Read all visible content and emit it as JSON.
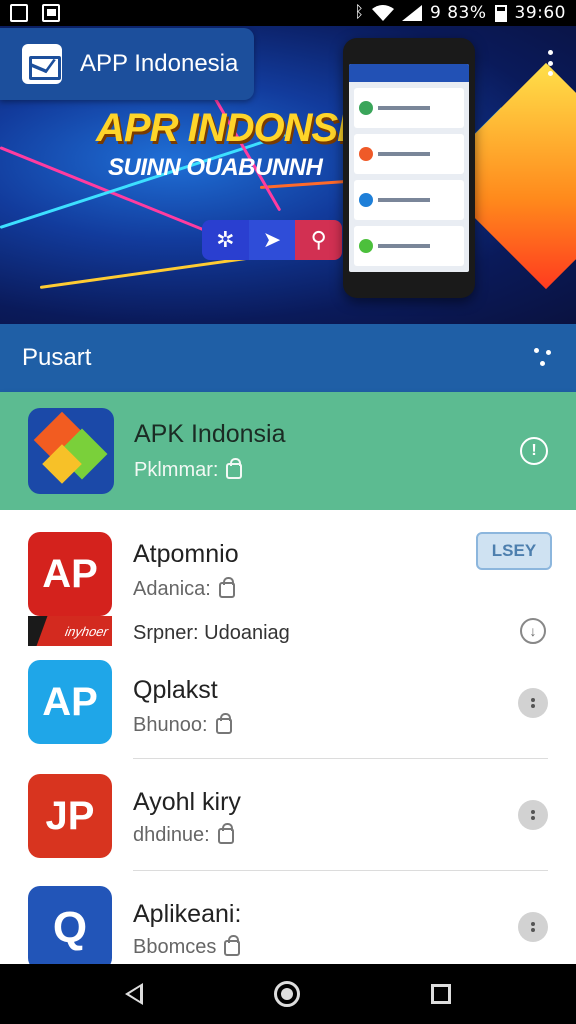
{
  "status_bar": {
    "battery_text": "9 83%",
    "time": "39:60",
    "icons": [
      "image-icon",
      "flag-icon",
      "bluetooth-icon",
      "wifi-icon",
      "signal-icon",
      "battery-icon"
    ]
  },
  "banner": {
    "app_title": "APP Indonesia",
    "headline": "APR INDONSIA",
    "subline": "SUINN OUABUNNH",
    "colors": {
      "headline": "#ffd52a",
      "bg": "#123b9c"
    }
  },
  "section": {
    "label": "Pusart"
  },
  "featured": {
    "name": "APK Indonsia",
    "sub": "Pklmmar:",
    "accent": "#5cbb91"
  },
  "list": [
    {
      "name": "Atpomnio",
      "sub": "Adanica:",
      "action": "LSEY",
      "promo_tag": "inyhoer",
      "promo_text": "Srpner: Udoaniag",
      "icon_text": "AP"
    },
    {
      "name": "Qplakst",
      "sub": "Bhunoo:",
      "icon_text": "AP"
    },
    {
      "name": "Ayohl kiry",
      "sub": "dhdinue:",
      "icon_text": "JP"
    },
    {
      "name": "Aplikeani:",
      "sub": "Bbomces",
      "icon_text": "Q"
    }
  ]
}
